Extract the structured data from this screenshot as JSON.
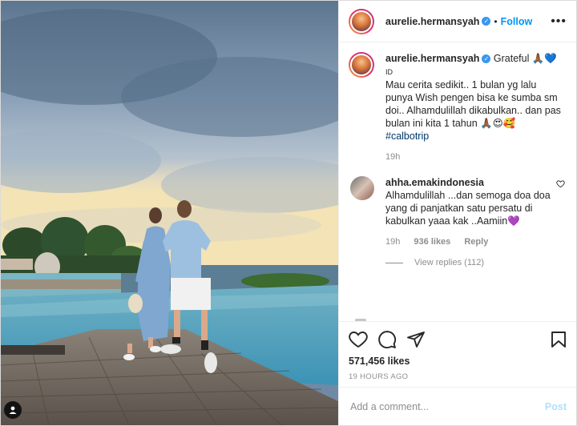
{
  "post": {
    "username": "aurelie.hermansyah",
    "follow_label": "Follow",
    "separator": "•",
    "more_label": "•••"
  },
  "caption": {
    "username": "aurelie.hermansyah",
    "first_line": "Grateful 🙏🏾💙",
    "second_line": "ID",
    "body": "Mau cerita sedikit.. 1 bulan yg lalu punya Wish pengen bisa ke sumba sm doi.. Alhamdulillah dikabulkan.. dan pas bulan ini kita 1 tahun 🙏🏾😍🥰",
    "hashtag": "#calbotrip",
    "time": "19h"
  },
  "comment": {
    "username": "ahha.emakindonesia",
    "text": "Alhamdulillah ...dan semoga doa doa yang di panjatkan satu persatu di kabulkan yaaa kak ..Aamiin💜",
    "time": "19h",
    "likes": "936 likes",
    "reply_label": "Reply",
    "view_replies": "View replies (112)"
  },
  "engagement": {
    "likes": "571,456 likes",
    "time_ago": "19 HOURS AGO"
  },
  "composer": {
    "placeholder": "Add a comment...",
    "post_label": "Post"
  },
  "icons": [
    "heart-icon",
    "comment-icon",
    "share-icon",
    "save-icon",
    "more-icon",
    "user-tag-icon",
    "verified-icon"
  ],
  "colors": {
    "link_blue": "#0095f6",
    "hashtag": "#00376b",
    "muted": "#8e8e8e",
    "post_disabled": "#b2dffc"
  }
}
